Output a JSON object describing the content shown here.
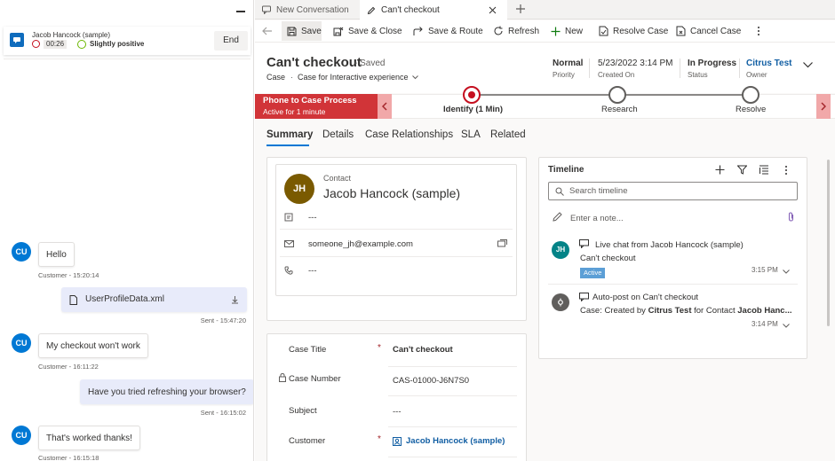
{
  "session": {
    "name": "Jacob Hancock (sample)",
    "timer": "00:26",
    "sentiment": "Slightly positive",
    "end_label": "End"
  },
  "chat": [
    {
      "from": "customer",
      "avatar": "CU",
      "text": "Hello",
      "meta": "Customer - 15:20:14"
    },
    {
      "from": "agent",
      "file": "UserProfileData.xml",
      "meta": "Sent - 15:47:20"
    },
    {
      "from": "customer",
      "avatar": "CU",
      "text": "My checkout won't work",
      "meta": "Customer - 16:11:22"
    },
    {
      "from": "agent",
      "text": "Have you tried refreshing your browser?",
      "meta": "Sent - 16:15:02"
    },
    {
      "from": "customer",
      "avatar": "CU",
      "text": "That's worked thanks!",
      "meta": "Customer - 16:15:18"
    }
  ],
  "tabs": [
    {
      "label": "New Conversation"
    },
    {
      "label": "Can't checkout"
    }
  ],
  "toolbar": {
    "save": "Save",
    "save_close": "Save & Close",
    "save_route": "Save & Route",
    "refresh": "Refresh",
    "new": "New",
    "resolve": "Resolve Case",
    "cancel": "Cancel Case"
  },
  "record": {
    "title": "Can't checkout",
    "saved": "- Saved",
    "entity": "Case",
    "form": "Case for Interactive experience",
    "priority_value": "Normal",
    "priority_label": "Priority",
    "created_value": "5/23/2022 3:14 PM",
    "created_label": "Created On",
    "status_value": "In Progress",
    "status_label": "Status",
    "owner_value": "Citrus Test",
    "owner_label": "Owner"
  },
  "bpf": {
    "process": "Phone to Case Process",
    "active_for": "Active for 1 minute",
    "stages": [
      "Identify  (1 Min)",
      "Research",
      "Resolve"
    ]
  },
  "form_tabs": [
    "Summary",
    "Details",
    "Case Relationships",
    "SLA",
    "Related"
  ],
  "contact": {
    "label": "Contact",
    "initials": "JH",
    "name": "Jacob Hancock (sample)",
    "field1": "---",
    "email": "someone_jh@example.com",
    "phone": "---"
  },
  "fields": [
    {
      "label": "Case Title",
      "required": "*",
      "value": "Can't checkout"
    },
    {
      "label": "Case Number",
      "value": "CAS-01000-J6N7S0"
    },
    {
      "label": "Subject",
      "value": "---"
    },
    {
      "label": "Customer",
      "required": "*",
      "value": "Jacob Hancock (sample)"
    }
  ],
  "timeline": {
    "title": "Timeline",
    "search_placeholder": "Search timeline",
    "note_placeholder": "Enter a note...",
    "items": [
      {
        "initials": "JH",
        "title": "Live chat from Jacob Hancock (sample)",
        "subtitle": "Can't checkout",
        "badge": "Active",
        "time": "3:15 PM"
      },
      {
        "title": "Auto-post on Can't checkout",
        "subtitle_prefix": "Case: Created by ",
        "subtitle_owner": "Citrus Test",
        "subtitle_mid": " for Contact ",
        "subtitle_contact": "Jacob Hanc...",
        "time": "3:14 PM"
      }
    ]
  },
  "colors": {
    "accent": "#0078d4",
    "bpf_red": "#d13438",
    "stage_red": "#c50f1f",
    "link": "#115ea3",
    "avatar_brown": "#7a5a00",
    "avatar_teal": "#038387"
  }
}
